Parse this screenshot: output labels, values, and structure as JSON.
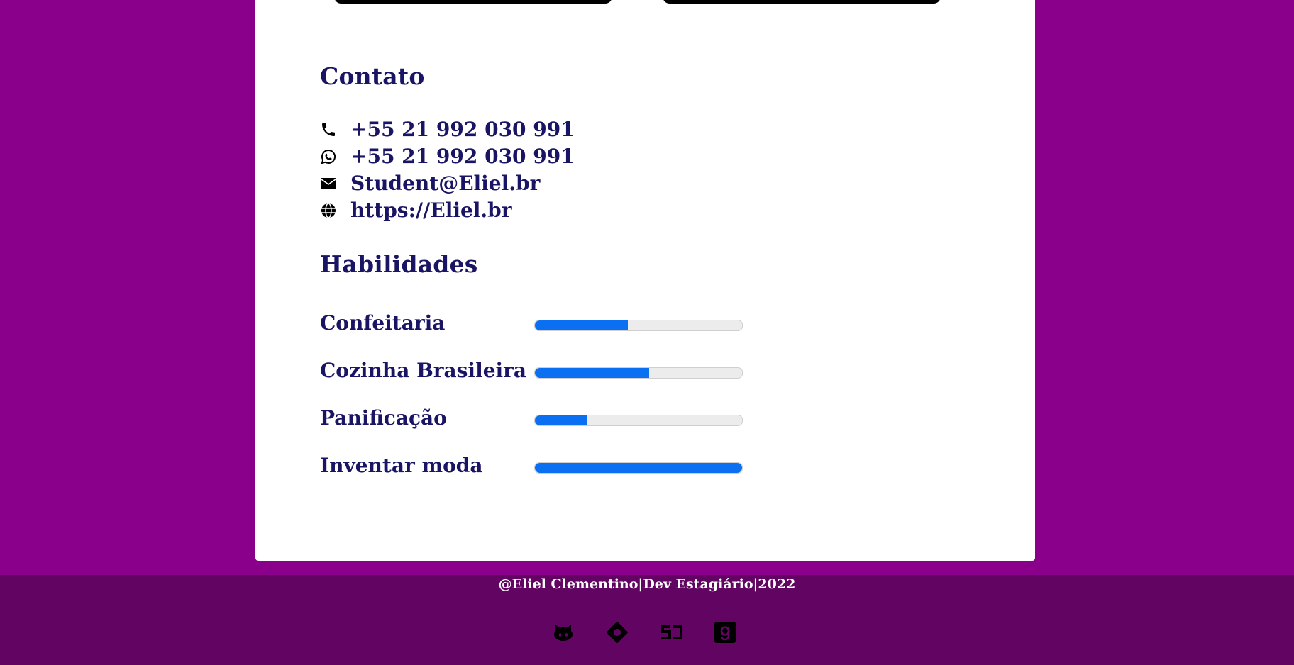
{
  "colors": {
    "page_background": "#8b008b",
    "card_background": "#ffffff",
    "heading_text": "#1a1464",
    "footer_background": "#620562",
    "progress_fill": "#0a6ff0",
    "progress_track": "#ececec"
  },
  "contact": {
    "title": "Contato",
    "items": [
      {
        "icon": "phone-icon",
        "text": "+55 21 992 030 991"
      },
      {
        "icon": "whatsapp-icon",
        "text": "+55 21 992 030 991"
      },
      {
        "icon": "envelope-icon",
        "text": "Student@Eliel.br"
      },
      {
        "icon": "globe-icon",
        "text": "https://Eliel.br"
      }
    ]
  },
  "skills": {
    "title": "Habilidades",
    "items": [
      {
        "name": "Confeitaria",
        "level_percent": 45
      },
      {
        "name": "Cozinha Brasileira",
        "level_percent": 55
      },
      {
        "name": "Panificação",
        "level_percent": 25
      },
      {
        "name": "Inventar moda",
        "level_percent": 100
      }
    ]
  },
  "footer": {
    "text": "@Eliel Clementino|Dev Estagiário|2022",
    "social": [
      {
        "icon": "github-icon"
      },
      {
        "icon": "codepen-icon"
      },
      {
        "icon": "sj-icon"
      },
      {
        "icon": "goodreads-icon"
      }
    ]
  }
}
